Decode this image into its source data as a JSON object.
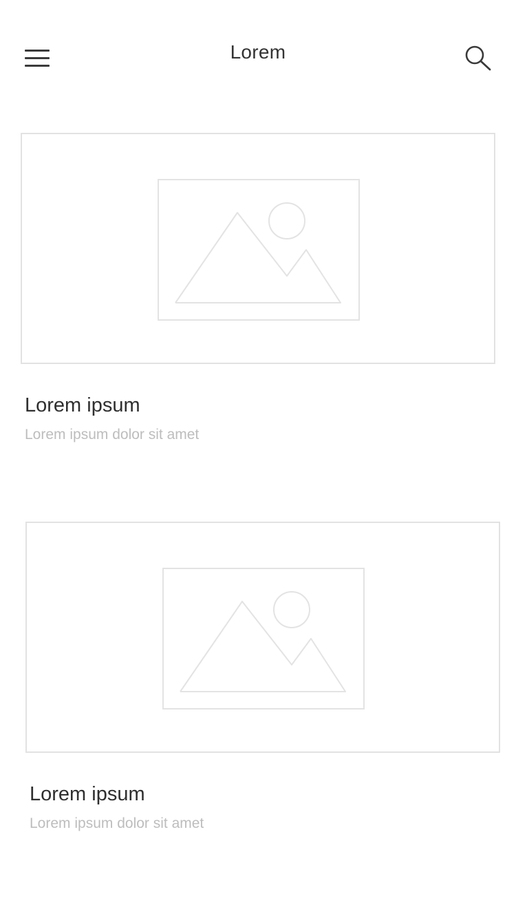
{
  "header": {
    "title": "Lorem",
    "menu_icon": "hamburger-menu-icon",
    "search_icon": "search-icon"
  },
  "cards": [
    {
      "image_icon": "image-placeholder-icon",
      "title": "Lorem ipsum",
      "subtitle": "Lorem ipsum dolor sit amet"
    },
    {
      "image_icon": "image-placeholder-icon",
      "title": "Lorem ipsum",
      "subtitle": "Lorem ipsum dolor sit amet"
    }
  ],
  "colors": {
    "text_primary": "#333333",
    "text_secondary": "#bdbdbd",
    "border": "#e2e2e2",
    "background": "#ffffff"
  }
}
